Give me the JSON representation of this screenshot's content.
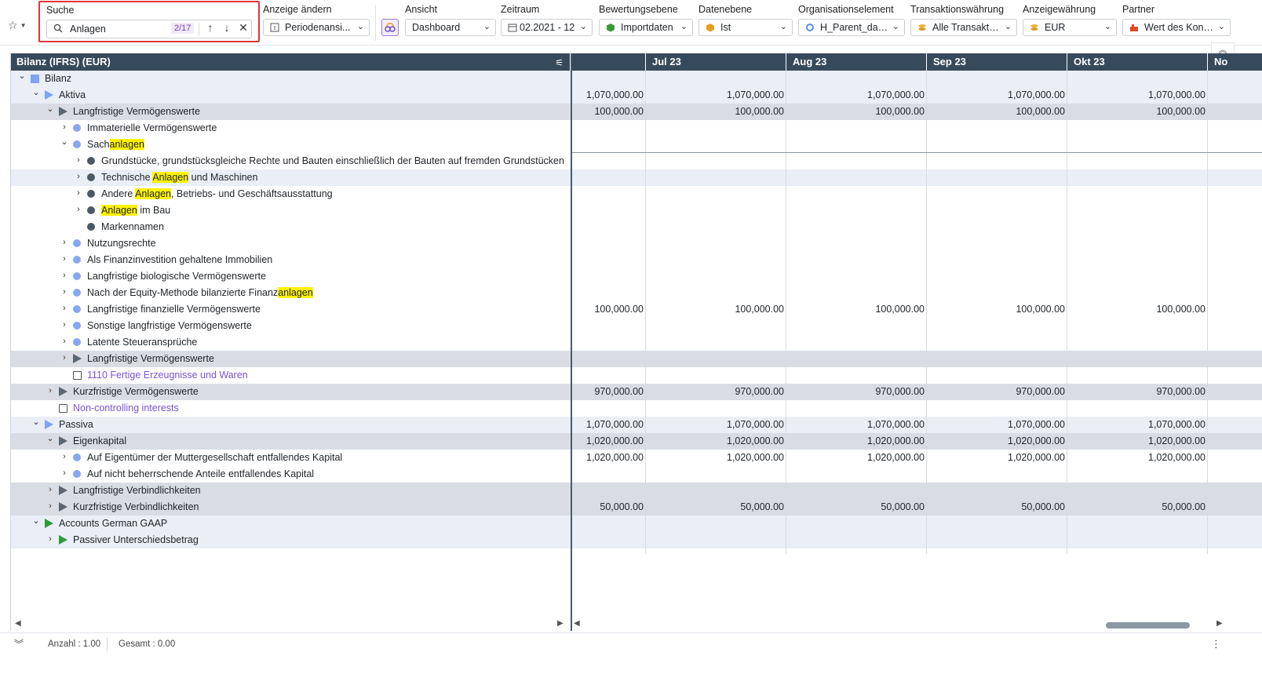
{
  "search": {
    "label": "Suche",
    "value": "Anlagen",
    "count": "2/17"
  },
  "fields": {
    "anzeige": {
      "label": "Anzeige ändern",
      "value": "Periodenansi..."
    },
    "ansicht": {
      "label": "Ansicht",
      "value": "Dashboard"
    },
    "zeitraum": {
      "label": "Zeitraum",
      "value": "02.2021 - 12"
    },
    "bewertung": {
      "label": "Bewertungsebene",
      "value": "Importdaten"
    },
    "datenebene": {
      "label": "Datenebene",
      "value": "Ist"
    },
    "org": {
      "label": "Organisationselement",
      "value": "H_Parent_data..."
    },
    "trans": {
      "label": "Transaktionswährung",
      "value": "Alle Transaktio..."
    },
    "anzw": {
      "label": "Anzeigewährung",
      "value": "EUR"
    },
    "partner": {
      "label": "Partner",
      "value": "Wert des Kontos"
    }
  },
  "grid": {
    "title": "Bilanz (IFRS) (EUR)",
    "columns": [
      "",
      "Jul 23",
      "Aug 23",
      "Sep 23",
      "Okt 23",
      "No"
    ]
  },
  "rows": [
    {
      "label": "Bilanz",
      "level": 0,
      "node": "sq",
      "expand": "down",
      "style": "alt",
      "values": [
        "",
        "",
        "",
        "",
        ""
      ]
    },
    {
      "label": "Aktiva",
      "level": 1,
      "node": "tri-b",
      "expand": "down",
      "style": "alt",
      "values": [
        "1,070,000.00",
        "1,070,000.00",
        "1,070,000.00",
        "1,070,000.00",
        "1,070,000.00"
      ]
    },
    {
      "label": "Langfristige Vermögenswerte",
      "level": 2,
      "node": "tri-g",
      "expand": "down",
      "style": "grp",
      "values": [
        "100,000.00",
        "100,000.00",
        "100,000.00",
        "100,000.00",
        "100,000.00"
      ]
    },
    {
      "label": "Immaterielle Vermögenswerte",
      "level": 3,
      "node": "dot-b",
      "expand": "right",
      "style": "",
      "values": [
        "",
        "",
        "",
        "",
        ""
      ]
    },
    {
      "label": "Sachanlagen",
      "level": 3,
      "node": "dot-b",
      "expand": "down",
      "style": "",
      "parts": [
        "Sach",
        "anlagen",
        ""
      ],
      "values": [
        "",
        "",
        "",
        "",
        ""
      ]
    },
    {
      "label": "Grundstücke, grundstücksgleiche Rechte und Bauten einschließlich der Bauten auf fremden Grundstücken",
      "level": 4,
      "node": "dot-d",
      "expand": "right",
      "style": "",
      "values": [
        "",
        "",
        "",
        "",
        ""
      ]
    },
    {
      "label": "Technische Anlagen und Maschinen",
      "level": 4,
      "node": "dot-d",
      "expand": "right",
      "style": "alt",
      "parts": [
        "Technische ",
        "Anlagen",
        " und Maschinen"
      ],
      "values": [
        "",
        "",
        "",
        "",
        ""
      ]
    },
    {
      "label": "Andere Anlagen, Betriebs- und Geschäftsausstattung",
      "level": 4,
      "node": "dot-d",
      "expand": "right",
      "style": "",
      "parts": [
        "Andere ",
        "Anlagen",
        ", Betriebs- und Geschäftsausstattung"
      ],
      "values": [
        "",
        "",
        "",
        "",
        ""
      ]
    },
    {
      "label": "Anlagen im Bau",
      "level": 4,
      "node": "dot-d",
      "expand": "right",
      "style": "",
      "parts": [
        "",
        "Anlagen",
        " im Bau"
      ],
      "values": [
        "",
        "",
        "",
        "",
        ""
      ]
    },
    {
      "label": "Markennamen",
      "level": 4,
      "node": "dot-d",
      "expand": "",
      "style": "",
      "values": [
        "",
        "",
        "",
        "",
        ""
      ]
    },
    {
      "label": "Nutzungsrechte",
      "level": 3,
      "node": "dot-b",
      "expand": "right",
      "style": "",
      "values": [
        "",
        "",
        "",
        "",
        ""
      ]
    },
    {
      "label": "Als Finanzinvestition gehaltene Immobilien",
      "level": 3,
      "node": "dot-b",
      "expand": "right",
      "style": "",
      "values": [
        "",
        "",
        "",
        "",
        ""
      ]
    },
    {
      "label": "Langfristige biologische Vermögenswerte",
      "level": 3,
      "node": "dot-b",
      "expand": "right",
      "style": "",
      "values": [
        "",
        "",
        "",
        "",
        ""
      ]
    },
    {
      "label": "Nach der Equity-Methode bilanzierte Finanzanlagen",
      "level": 3,
      "node": "dot-b",
      "expand": "right",
      "style": "",
      "parts": [
        "Nach der Equity-Methode bilanzierte Finanz",
        "anlagen",
        ""
      ],
      "values": [
        "",
        "",
        "",
        "",
        ""
      ]
    },
    {
      "label": "Langfristige finanzielle Vermögenswerte",
      "level": 3,
      "node": "dot-b",
      "expand": "right",
      "style": "",
      "values": [
        "100,000.00",
        "100,000.00",
        "100,000.00",
        "100,000.00",
        "100,000.00"
      ]
    },
    {
      "label": "Sonstige langfristige Vermögenswerte",
      "level": 3,
      "node": "dot-b",
      "expand": "right",
      "style": "",
      "values": [
        "",
        "",
        "",
        "",
        ""
      ]
    },
    {
      "label": "Latente Steueransprüche",
      "level": 3,
      "node": "dot-b",
      "expand": "right",
      "style": "",
      "values": [
        "",
        "",
        "",
        "",
        ""
      ]
    },
    {
      "label": "Langfristige Vermögenswerte",
      "level": 3,
      "node": "tri-g",
      "expand": "right",
      "style": "grp",
      "values": [
        "",
        "",
        "",
        "",
        ""
      ]
    },
    {
      "label": "1110 Fertige Erzeugnisse und Waren",
      "level": 3,
      "node": "doc",
      "expand": "",
      "style": "",
      "link": true,
      "values": [
        "",
        "",
        "",
        "",
        ""
      ]
    },
    {
      "label": "Kurzfristige Vermögenswerte",
      "level": 2,
      "node": "tri-g",
      "expand": "right",
      "style": "grp",
      "values": [
        "970,000.00",
        "970,000.00",
        "970,000.00",
        "970,000.00",
        "970,000.00"
      ]
    },
    {
      "label": "Non-controlling interests",
      "level": 2,
      "node": "doc",
      "expand": "",
      "style": "",
      "link": true,
      "values": [
        "",
        "",
        "",
        "",
        ""
      ]
    },
    {
      "label": "Passiva",
      "level": 1,
      "node": "tri-b",
      "expand": "down",
      "style": "alt",
      "values": [
        "1,070,000.00",
        "1,070,000.00",
        "1,070,000.00",
        "1,070,000.00",
        "1,070,000.00"
      ]
    },
    {
      "label": "Eigenkapital",
      "level": 2,
      "node": "tri-g",
      "expand": "down",
      "style": "grp",
      "values": [
        "1,020,000.00",
        "1,020,000.00",
        "1,020,000.00",
        "1,020,000.00",
        "1,020,000.00"
      ]
    },
    {
      "label": "Auf Eigentümer der Muttergesellschaft entfallendes Kapital",
      "level": 3,
      "node": "dot-b",
      "expand": "right",
      "style": "",
      "values": [
        "1,020,000.00",
        "1,020,000.00",
        "1,020,000.00",
        "1,020,000.00",
        "1,020,000.00"
      ]
    },
    {
      "label": "Auf nicht beherrschende Anteile entfallendes Kapital",
      "level": 3,
      "node": "dot-b",
      "expand": "right",
      "style": "",
      "values": [
        "",
        "",
        "",
        "",
        ""
      ]
    },
    {
      "label": "Langfristige Verbindlichkeiten",
      "level": 2,
      "node": "tri-g",
      "expand": "right",
      "style": "grp",
      "values": [
        "",
        "",
        "",
        "",
        ""
      ]
    },
    {
      "label": "Kurzfristige Verbindlichkeiten",
      "level": 2,
      "node": "tri-g",
      "expand": "right",
      "style": "grp",
      "values": [
        "50,000.00",
        "50,000.00",
        "50,000.00",
        "50,000.00",
        "50,000.00"
      ]
    },
    {
      "label": "Accounts German GAAP",
      "level": 1,
      "node": "tri-gr",
      "expand": "down",
      "style": "alt",
      "values": [
        "",
        "",
        "",
        "",
        ""
      ]
    },
    {
      "label": "Passiver Unterschiedsbetrag",
      "level": 2,
      "node": "tri-gr",
      "expand": "right",
      "style": "alt",
      "values": [
        "",
        "",
        "",
        "",
        ""
      ]
    }
  ],
  "status": {
    "anzahl": "Anzahl : 1.00",
    "gesamt": "Gesamt : 0.00"
  }
}
